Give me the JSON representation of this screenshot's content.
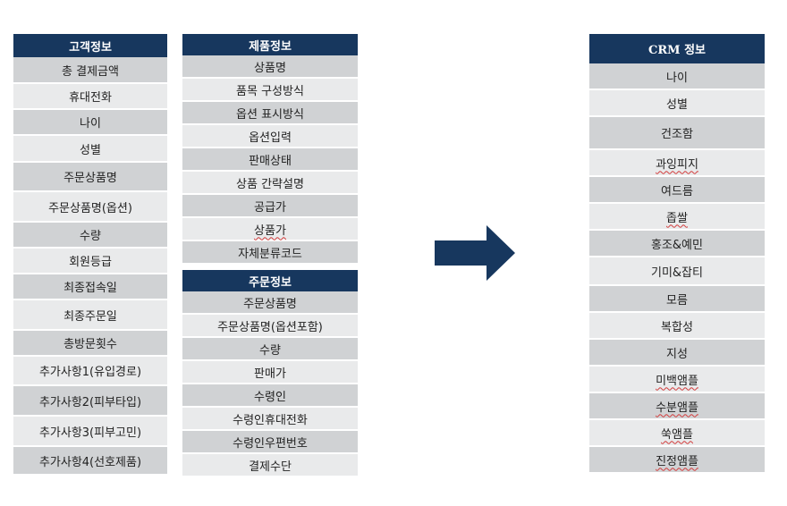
{
  "customer": {
    "title": "고객정보",
    "items": [
      "총 결제금액",
      "휴대전화",
      "나이",
      "성별",
      "주문상품명",
      "주문상품명(옵션)",
      "수량",
      "회원등급",
      "최종접속일",
      "최종주문일",
      "총방문횟수",
      "추가사항1(유입경로)",
      "추가사항2(피부타입)",
      "추가사항3(피부고민)",
      "추가사항4(선호제품)"
    ]
  },
  "product": {
    "title": "제품정보",
    "items": [
      "상품명",
      "품목 구성방식",
      "옵션 표시방식",
      "옵션입력",
      "판매상태",
      "상품 간략설명",
      "공급가",
      "상품가",
      "자체분류코드"
    ]
  },
  "order": {
    "title": "주문정보",
    "items": [
      "주문상품명",
      "주문상품명(옵션포함)",
      "수량",
      "판매가",
      "수령인",
      "수령인휴대전화",
      "수령인우편번호",
      "결제수단"
    ]
  },
  "crm": {
    "title": "CRM 정보",
    "items": [
      "나이",
      "성별",
      "건조함",
      "과잉피지",
      "여드름",
      "좁쌀",
      "홍조&예민",
      "기미&잡티",
      "모름",
      "복합성",
      "지성",
      "미백앰플",
      "수분앰플",
      "쑥앰플",
      "진정앰플"
    ]
  },
  "colors": {
    "header": "#17375e",
    "row_dark": "#d0d2d4",
    "row_light": "#e9eaeb",
    "arrow": "#17375e",
    "spell_underline": "#d23c3c"
  },
  "icons": {
    "arrow": "right-arrow-icon"
  }
}
